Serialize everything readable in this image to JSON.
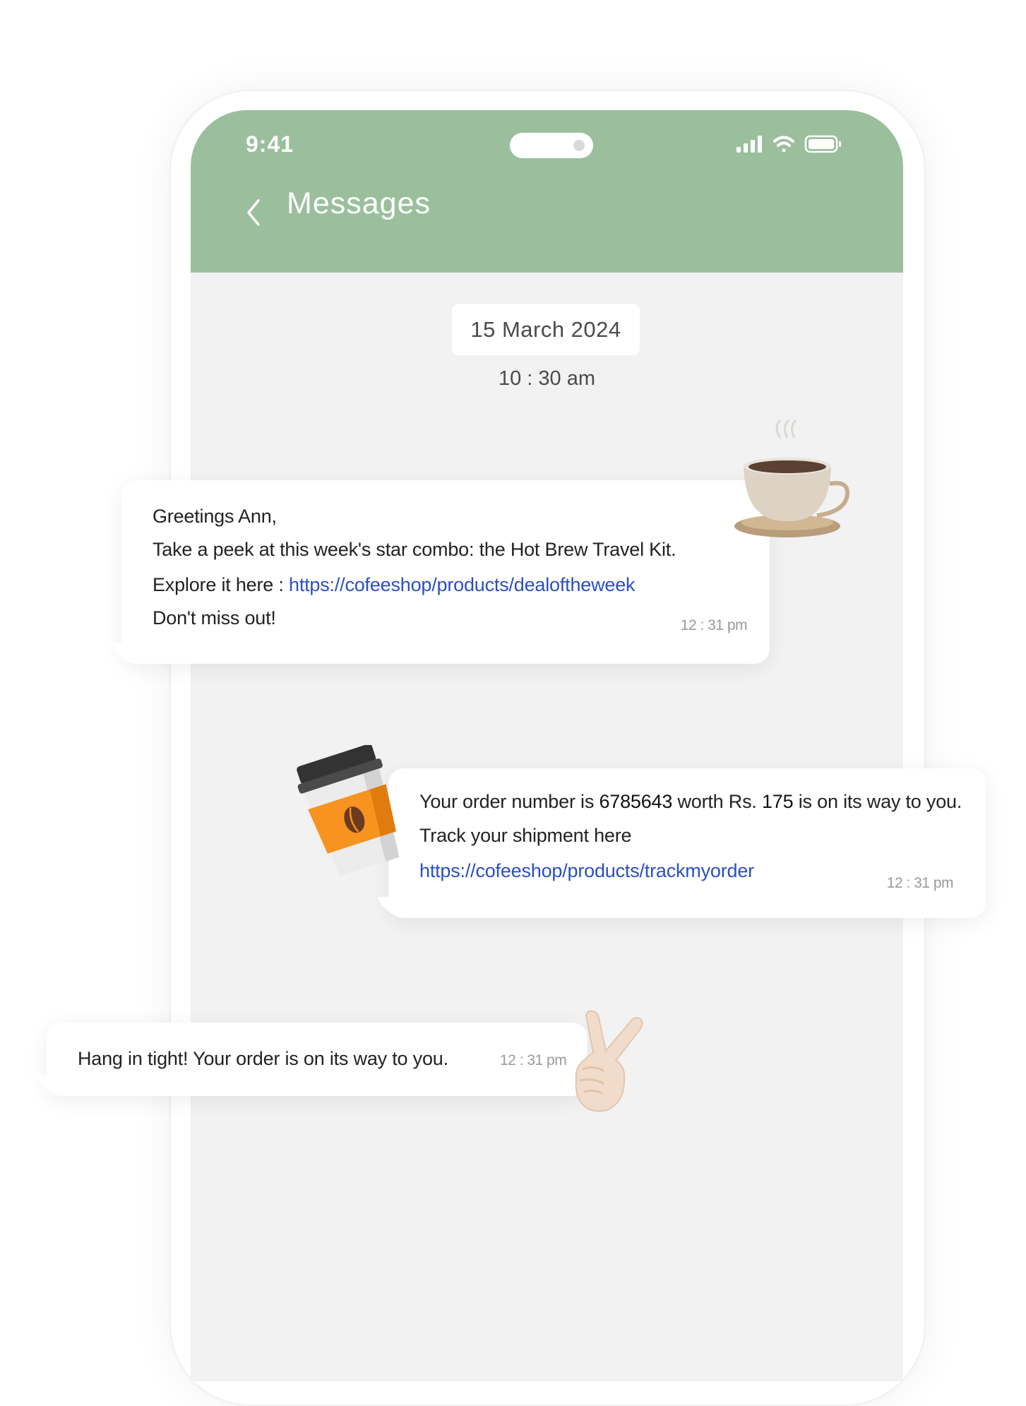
{
  "status_bar": {
    "time": "9:41"
  },
  "header": {
    "title": "Messages"
  },
  "conversation": {
    "date": "15 March 2024",
    "time": "10 : 30 am"
  },
  "messages": [
    {
      "greeting": "Greetings Ann,",
      "line2": "Take a peek at this week's star combo: the Hot Brew Travel Kit.",
      "line3_prefix": "Explore it here : ",
      "link": "https://cofeeshop/products/dealoftheweek",
      "line4": "Don't miss out!",
      "timestamp": "12 : 31 pm"
    },
    {
      "line1_a": "Your order number is ",
      "order_number": "6785643",
      "line1_b": " worth Rs. ",
      "amount": "175",
      "line1_c": " is on its way to you.",
      "line2": "Track your shipment here",
      "link": "https://cofeeshop/products/trackmyorder",
      "timestamp": "12 : 31 pm"
    },
    {
      "text": "Hang in tight! Your order is on its way to you.",
      "timestamp": "12 : 31 pm"
    }
  ],
  "colors": {
    "header_green": "#9bbf9d",
    "chat_background": "#f2f2f3",
    "link_blue": "#2b4fbf",
    "cup_orange": "#f7931e"
  },
  "icons": [
    "chevron-left-icon",
    "signal-icon",
    "wifi-icon",
    "battery-icon",
    "coffee-cup-sticker",
    "takeaway-cup-sticker",
    "peace-hand-sticker"
  ]
}
